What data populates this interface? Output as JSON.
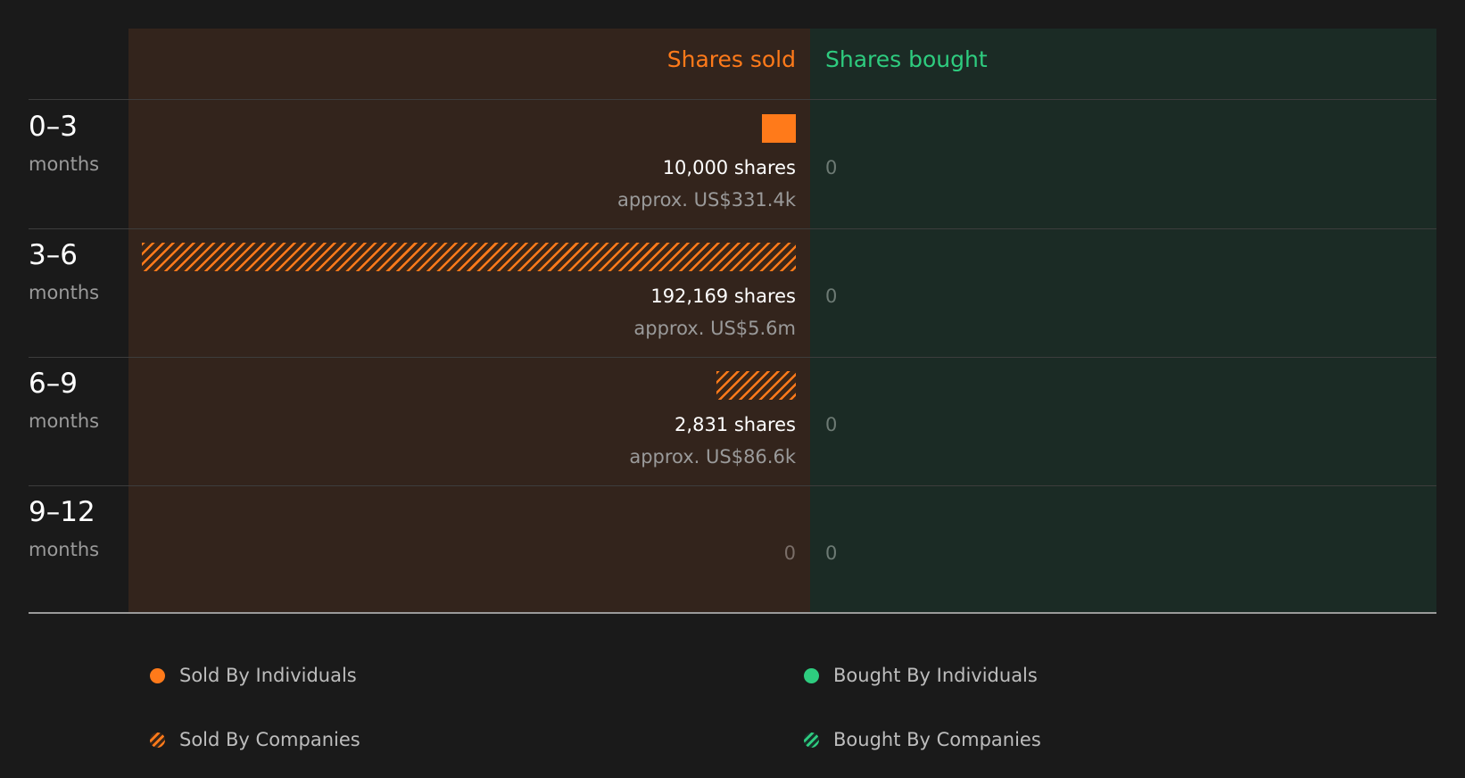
{
  "chart_data": {
    "type": "bar",
    "columns": {
      "sold_header": "Shares sold",
      "bought_header": "Shares bought"
    },
    "periods": [
      {
        "label": "0–3",
        "unit": "months",
        "sold": {
          "shares": 10000,
          "shares_text": "10,000 shares",
          "value_text": "approx. US$331.4k",
          "by": "individuals"
        },
        "bought": {
          "shares": 0,
          "text": "0"
        }
      },
      {
        "label": "3–6",
        "unit": "months",
        "sold": {
          "shares": 192169,
          "shares_text": "192,169 shares",
          "value_text": "approx. US$5.6m",
          "by": "companies"
        },
        "bought": {
          "shares": 0,
          "text": "0"
        }
      },
      {
        "label": "6–9",
        "unit": "months",
        "sold": {
          "shares": 2831,
          "shares_text": "2,831 shares",
          "value_text": "approx. US$86.6k",
          "by": "companies"
        },
        "bought": {
          "shares": 0,
          "text": "0"
        }
      },
      {
        "label": "9–12",
        "unit": "months",
        "sold": {
          "shares": 0,
          "zero_text": "0",
          "by": "none"
        },
        "bought": {
          "shares": 0,
          "text": "0"
        }
      }
    ],
    "max_shares": 192169,
    "legend": [
      {
        "label": "Sold By Individuals",
        "swatch": "solid",
        "color": "#ff7a1a"
      },
      {
        "label": "Bought By Individuals",
        "swatch": "solid",
        "color": "#2ecc7f"
      },
      {
        "label": "Sold By Companies",
        "swatch": "hatched",
        "color": "#ff7a1a"
      },
      {
        "label": "Bought By Companies",
        "swatch": "hatched",
        "color": "#2ecc7f"
      }
    ],
    "colors": {
      "sold": "#ff7a1a",
      "bought": "#2ecc7f",
      "background": "#1a1a1a",
      "sold_panel": "#33241c",
      "bought_panel": "#1b2b25"
    }
  }
}
